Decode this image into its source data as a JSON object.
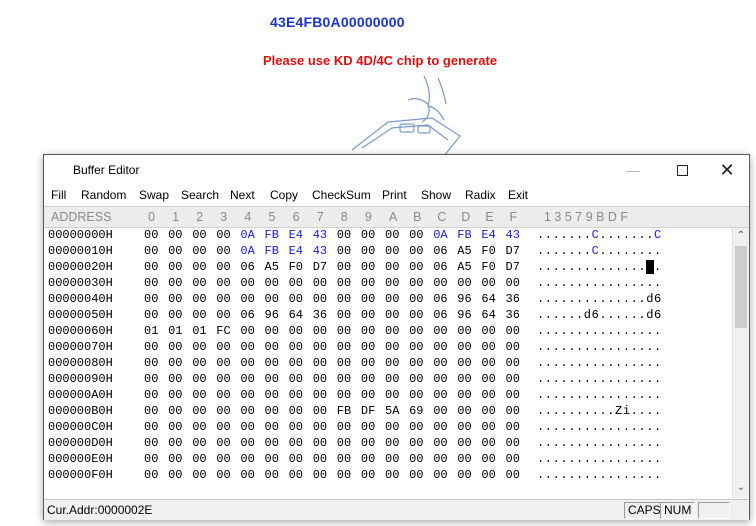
{
  "background": {
    "id_text": "43E4FB0A00000000",
    "warning": "Please use KD 4D/4C chip to generate"
  },
  "window": {
    "title": "Buffer Editor",
    "controls": {
      "minimize": "minimize-icon",
      "maximize": "maximize-icon",
      "close": "close-icon"
    }
  },
  "menu": [
    "Fill",
    "Random",
    "Swap",
    "Search",
    "Next",
    "Copy",
    "CheckSum",
    "Print",
    "Show",
    "Radix",
    "Exit"
  ],
  "header": {
    "address": "ADDRESS",
    "columns": [
      "0",
      "1",
      "2",
      "3",
      "4",
      "5",
      "6",
      "7",
      "8",
      "9",
      "A",
      "B",
      "C",
      "D",
      "E",
      "F"
    ],
    "ascii": "1 3 5 7 9 B D F"
  },
  "rows": [
    {
      "addr": "00000000H",
      "bytes": [
        "00",
        "00",
        "00",
        "00",
        "0A",
        "FB",
        "E4",
        "43",
        "00",
        "00",
        "00",
        "00",
        "0A",
        "FB",
        "E4",
        "43"
      ],
      "ascii": ".......C.......C"
    },
    {
      "addr": "00000010H",
      "bytes": [
        "00",
        "00",
        "00",
        "00",
        "0A",
        "FB",
        "E4",
        "43",
        "00",
        "00",
        "00",
        "00",
        "06",
        "A5",
        "F0",
        "D7"
      ],
      "ascii": ".......C........"
    },
    {
      "addr": "00000020H",
      "bytes": [
        "00",
        "00",
        "00",
        "00",
        "06",
        "A5",
        "F0",
        "D7",
        "00",
        "00",
        "00",
        "00",
        "06",
        "A5",
        "F0",
        "D7"
      ],
      "ascii": "................"
    },
    {
      "addr": "00000030H",
      "bytes": [
        "00",
        "00",
        "00",
        "00",
        "00",
        "00",
        "00",
        "00",
        "00",
        "00",
        "00",
        "00",
        "00",
        "00",
        "00",
        "00"
      ],
      "ascii": "................"
    },
    {
      "addr": "00000040H",
      "bytes": [
        "00",
        "00",
        "00",
        "00",
        "00",
        "00",
        "00",
        "00",
        "00",
        "00",
        "00",
        "00",
        "06",
        "96",
        "64",
        "36"
      ],
      "ascii": "..............d6"
    },
    {
      "addr": "00000050H",
      "bytes": [
        "00",
        "00",
        "00",
        "00",
        "06",
        "96",
        "64",
        "36",
        "00",
        "00",
        "00",
        "00",
        "06",
        "96",
        "64",
        "36"
      ],
      "ascii": "......d6......d6"
    },
    {
      "addr": "00000060H",
      "bytes": [
        "01",
        "01",
        "01",
        "FC",
        "00",
        "00",
        "00",
        "00",
        "00",
        "00",
        "00",
        "00",
        "00",
        "00",
        "00",
        "00"
      ],
      "ascii": "................"
    },
    {
      "addr": "00000070H",
      "bytes": [
        "00",
        "00",
        "00",
        "00",
        "00",
        "00",
        "00",
        "00",
        "00",
        "00",
        "00",
        "00",
        "00",
        "00",
        "00",
        "00"
      ],
      "ascii": "................"
    },
    {
      "addr": "00000080H",
      "bytes": [
        "00",
        "00",
        "00",
        "00",
        "00",
        "00",
        "00",
        "00",
        "00",
        "00",
        "00",
        "00",
        "00",
        "00",
        "00",
        "00"
      ],
      "ascii": "................"
    },
    {
      "addr": "00000090H",
      "bytes": [
        "00",
        "00",
        "00",
        "00",
        "00",
        "00",
        "00",
        "00",
        "00",
        "00",
        "00",
        "00",
        "00",
        "00",
        "00",
        "00"
      ],
      "ascii": "................"
    },
    {
      "addr": "000000A0H",
      "bytes": [
        "00",
        "00",
        "00",
        "00",
        "00",
        "00",
        "00",
        "00",
        "00",
        "00",
        "00",
        "00",
        "00",
        "00",
        "00",
        "00"
      ],
      "ascii": "................"
    },
    {
      "addr": "000000B0H",
      "bytes": [
        "00",
        "00",
        "00",
        "00",
        "00",
        "00",
        "00",
        "00",
        "FB",
        "DF",
        "5A",
        "69",
        "00",
        "00",
        "00",
        "00"
      ],
      "ascii": "..........Zi...."
    },
    {
      "addr": "000000C0H",
      "bytes": [
        "00",
        "00",
        "00",
        "00",
        "00",
        "00",
        "00",
        "00",
        "00",
        "00",
        "00",
        "00",
        "00",
        "00",
        "00",
        "00"
      ],
      "ascii": "................"
    },
    {
      "addr": "000000D0H",
      "bytes": [
        "00",
        "00",
        "00",
        "00",
        "00",
        "00",
        "00",
        "00",
        "00",
        "00",
        "00",
        "00",
        "00",
        "00",
        "00",
        "00"
      ],
      "ascii": "................"
    },
    {
      "addr": "000000E0H",
      "bytes": [
        "00",
        "00",
        "00",
        "00",
        "00",
        "00",
        "00",
        "00",
        "00",
        "00",
        "00",
        "00",
        "00",
        "00",
        "00",
        "00"
      ],
      "ascii": "................"
    },
    {
      "addr": "000000F0H",
      "bytes": [
        "00",
        "00",
        "00",
        "00",
        "00",
        "00",
        "00",
        "00",
        "00",
        "00",
        "00",
        "00",
        "00",
        "00",
        "00",
        "00"
      ],
      "ascii": "................"
    }
  ],
  "highlight_rule": "0A FB E4 43 byte groups shown in blue",
  "colors": {
    "highlight": "#1a1ad6",
    "warning": "#e01010",
    "id": "#1a33cc"
  },
  "status": {
    "cur_addr": "Cur.Addr:0000002E",
    "caps": "CAPS",
    "num": "NUM"
  }
}
